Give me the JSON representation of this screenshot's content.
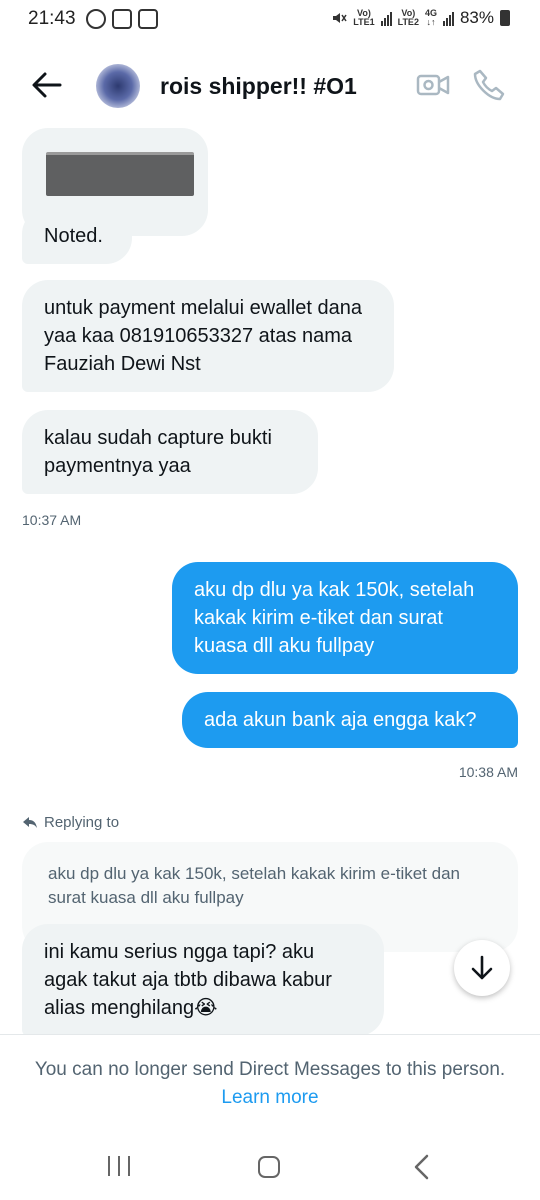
{
  "status_bar": {
    "time": "21:43",
    "network_1": "LTE1",
    "network_2": "LTE2",
    "network_type": "4G",
    "battery": "83%"
  },
  "header": {
    "title": "rois shipper!! #O1"
  },
  "messages": [
    {
      "type": "media",
      "direction": "incoming"
    },
    {
      "text": "Noted.",
      "direction": "incoming"
    },
    {
      "text": "untuk payment melalui ewallet dana yaa kaa 081910653327 atas nama Fauziah Dewi Nst",
      "direction": "incoming"
    },
    {
      "text": "kalau sudah capture bukti paymentnya yaa",
      "direction": "incoming",
      "timestamp": "10:37 AM"
    },
    {
      "text": "aku dp dlu ya kak 150k, setelah kakak kirim e-tiket dan surat kuasa dll aku fullpay",
      "direction": "outgoing"
    },
    {
      "text": "ada akun bank aja engga kak?",
      "direction": "outgoing",
      "timestamp": "10:38 AM"
    },
    {
      "text": "ini kamu serius ngga tapi? aku agak takut aja tbtb dibawa kabur alias menghilang😭",
      "direction": "incoming",
      "replying_to_label": "Replying to",
      "quoted_text": "aku dp dlu ya kak 150k, setelah kakak kirim e-tiket dan surat kuasa dll aku fullpay"
    }
  ],
  "footer": {
    "notice": "You can no longer send Direct Messages to this person.",
    "link": "Learn more"
  },
  "colors": {
    "accent": "#1d9bf0",
    "incoming_bubble": "#eff3f4",
    "secondary_text": "#536471"
  }
}
